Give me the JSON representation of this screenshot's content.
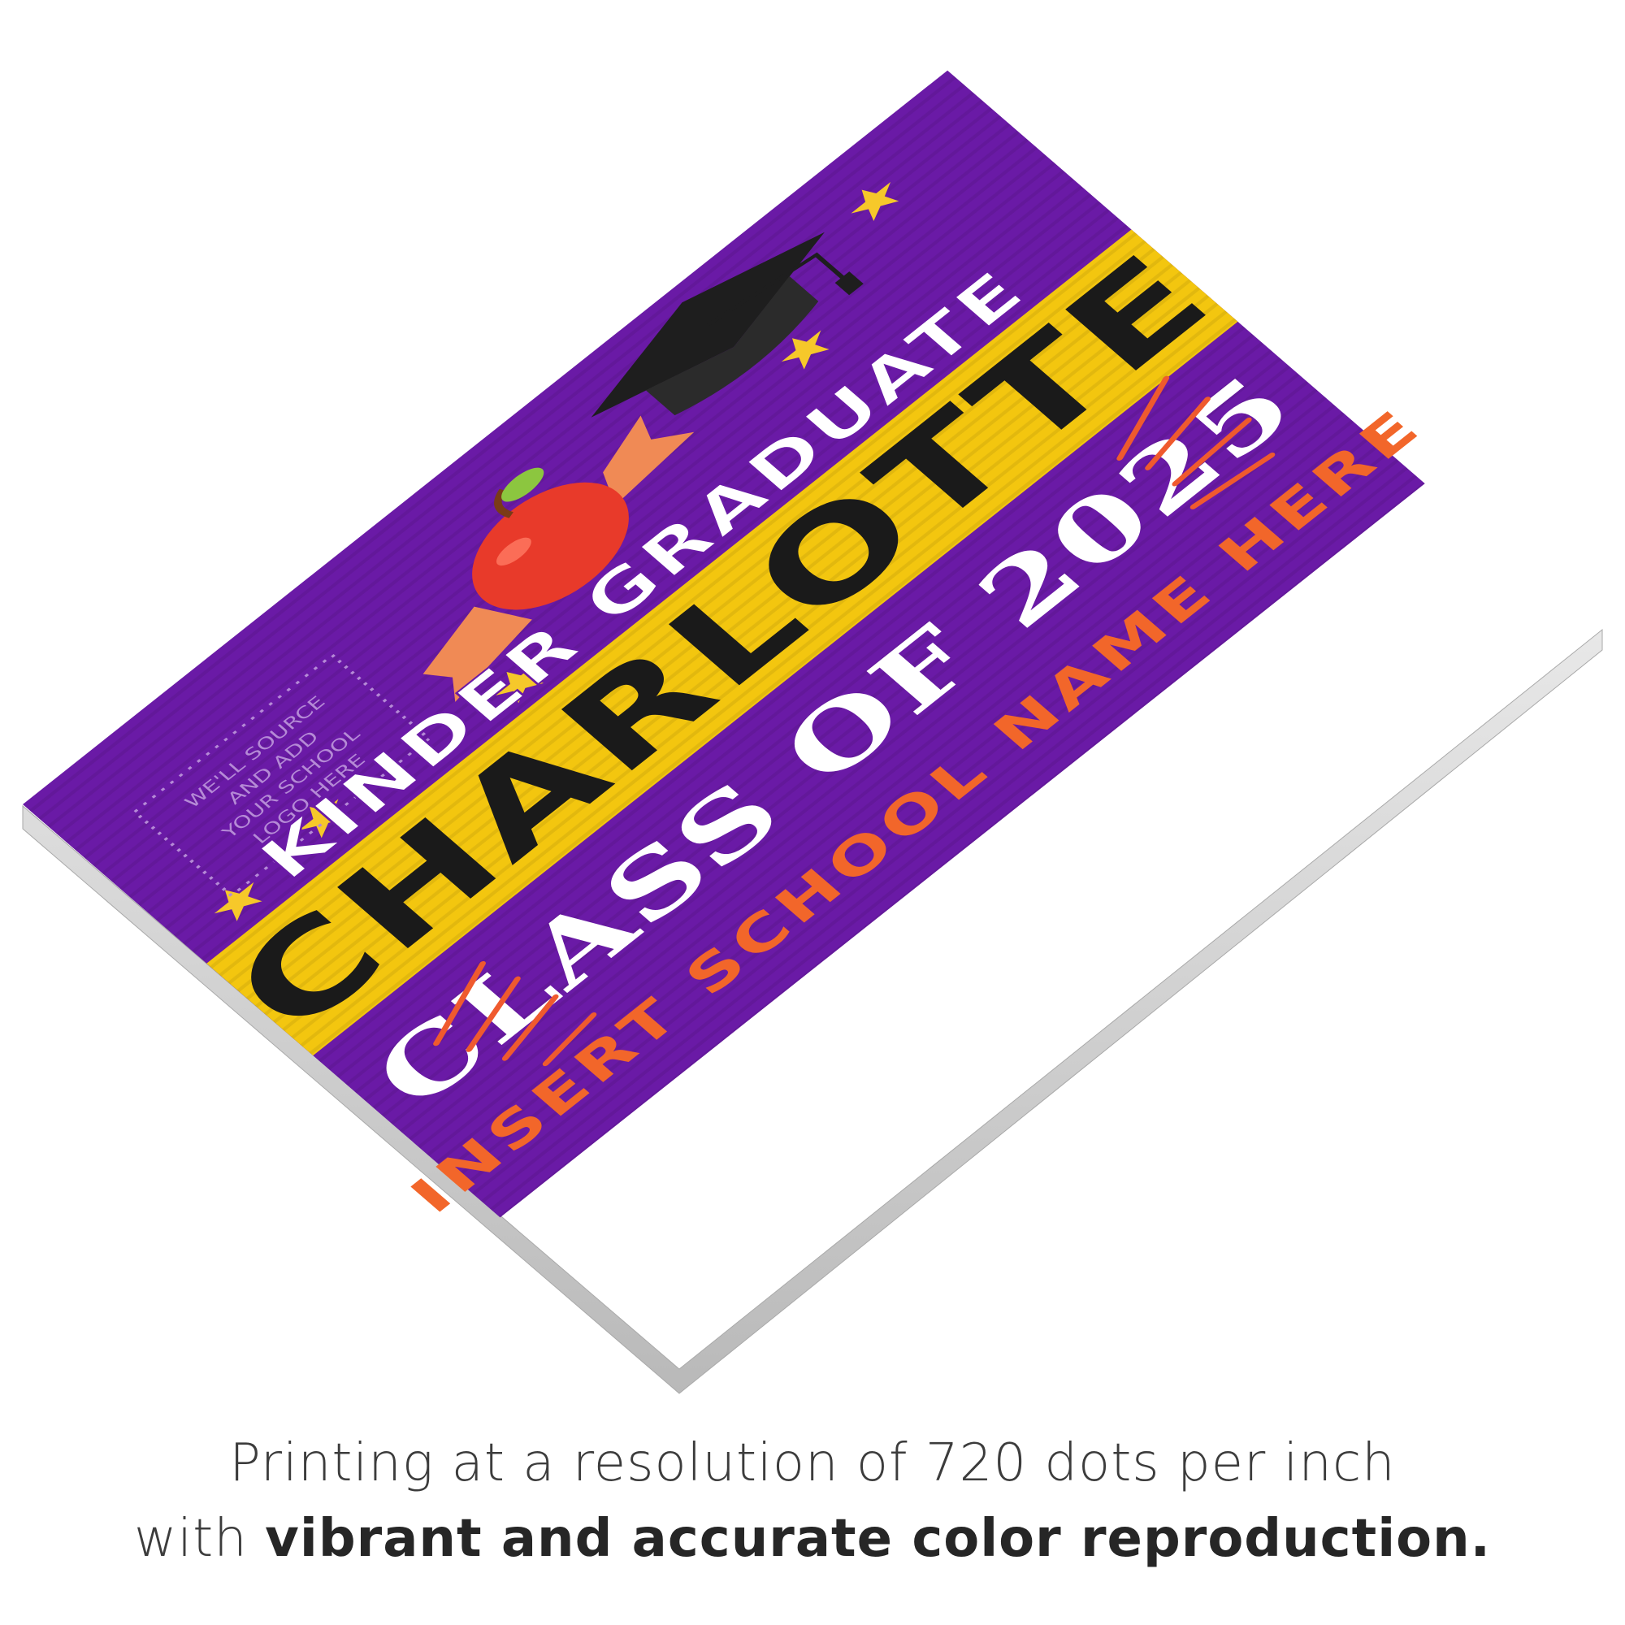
{
  "sign": {
    "subtitle": "KINDER GRADUATE",
    "name": "CHARLOTTE",
    "class_line": "CLASS OF 2025",
    "school": "INSERT SCHOOL NAME HERE",
    "logo_placeholder": [
      "WE'LL SOURCE",
      "AND ADD",
      "YOUR SCHOOL",
      "LOGO HERE"
    ]
  },
  "caption": {
    "line1": "Printing at a resolution of 720 dots per inch",
    "line2_prefix": "with ",
    "line2_emphasis": "vibrant and accurate color reproduction."
  },
  "colors": {
    "background": "#ffffff",
    "board_purple": "#6a1aa6",
    "band_yellow": "#f3c60f",
    "name_text": "#1a1a1a",
    "class_text": "#ffffff",
    "school_text": "#f2662a",
    "star_yellow": "#f6c82a",
    "apple_red": "#e83a2a",
    "ribbon_orange": "#f08a55",
    "burst_orange": "#ef5a2e",
    "caption_text": "#333333"
  },
  "icons": [
    "graduation-cap-icon",
    "apple-icon",
    "star-icon",
    "burst-lines-icon"
  ]
}
